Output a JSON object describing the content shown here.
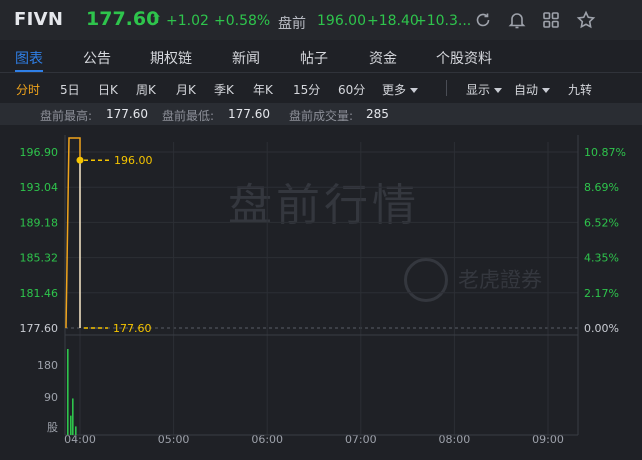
{
  "header": {
    "symbol": "FIVN",
    "price": "177.60",
    "arrow": "⬆",
    "change": "+1.02",
    "change_pct": "+0.58%",
    "premarket_label": "盘前",
    "premarket_price": "196.00",
    "premarket_change": "+18.40",
    "premarket_pct": "+10.3...",
    "icons": [
      "refresh-icon",
      "bell-icon",
      "grid-icon",
      "star-icon"
    ]
  },
  "tabs": [
    "图表",
    "公告",
    "期权链",
    "新闻",
    "帖子",
    "资金",
    "个股资料"
  ],
  "active_tab": "图表",
  "periods": [
    "分时",
    "5日",
    "日K",
    "周K",
    "月K",
    "季K",
    "年K",
    "15分",
    "60分",
    "更多"
  ],
  "active_period": "分时",
  "view_controls": [
    "显示",
    "自动",
    "九转"
  ],
  "stats": {
    "high_label": "盘前最高:",
    "high_value": "177.60",
    "low_label": "盘前最低:",
    "low_value": "177.60",
    "volume_label": "盘前成交量:",
    "volume_value": "285"
  },
  "watermark": {
    "main": "盘前行情",
    "brand": "老虎證券"
  },
  "colors": {
    "up": "#2ec44c",
    "accent": "#2f7fe6",
    "active_period": "#f0a41c",
    "price_line": "#f0a41c",
    "label": "#f5c400"
  },
  "chart_data": {
    "type": "line",
    "y_left_ticks": [
      "196.90",
      "193.04",
      "189.18",
      "185.32",
      "181.46",
      "177.60"
    ],
    "y_right_ticks": [
      "10.87%",
      "8.69%",
      "6.52%",
      "4.35%",
      "2.17%",
      "0.00%"
    ],
    "x_ticks": [
      "04:00",
      "05:00",
      "06:00",
      "07:00",
      "08:00",
      "09:00"
    ],
    "volume_ticks": [
      "180",
      "90"
    ],
    "volume_axis_label": "股",
    "ylim": [
      177.6,
      196.9
    ],
    "series": [
      {
        "values": [
          177.6,
          196.9,
          196.9,
          177.6
        ]
      }
    ],
    "high_marker": {
      "value": 196.0,
      "label": "196.00"
    },
    "low_marker": {
      "value": 177.6,
      "label": "177.60"
    },
    "volume": [
      200,
      45,
      85,
      20
    ]
  }
}
